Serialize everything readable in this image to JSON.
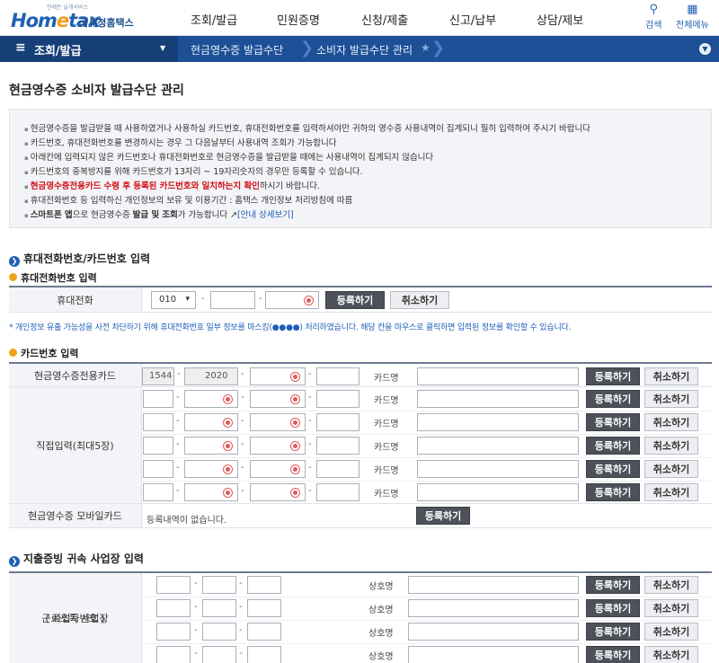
{
  "header": {
    "logo_tag": "언제든 날개서비스",
    "logo_main_a": "Hom",
    "logo_main_e": "e",
    "logo_main_b": "tax",
    "logo_sub": "국세청홈택스",
    "nav": [
      "조회/발급",
      "민원증명",
      "신청/제출",
      "신고/납부",
      "상담/제보"
    ],
    "search_label": "검색",
    "menu_label": "전체메뉴",
    "search_icon": "search-icon",
    "menu_icon": "grid-icon"
  },
  "breadcrumb": {
    "menu_glyph": "≡",
    "section": "조회/발급",
    "item1": "현금영수증 발급수단",
    "item2": "소비자 발급수단 관리"
  },
  "page_title": "현금영수증 소비자 발급수단 관리",
  "notice": {
    "lines": [
      "현금영수증을 발급받을 때 사용하였거나 사용하실 카드번호, 휴대전화번호를 입력하셔야만 귀하의 영수증 사용내역이 집계되니 필히 입력하여 주시기 바랍니다",
      "카드번호, 휴대전화번호를 변경하시는 경우 그 다음날부터 사용내역 조회가 가능합니다",
      "아래칸에 입력되지 않은 카드번호나 휴대전화번호로 현금영수증을 발급받을 때에는 사용내역이 집계되지 않습니다",
      "카드번호의 중복방지를 위해 카드번호가 13자리 ~ 19자리숫자의 경우만 등록할 수 있습니다."
    ],
    "red_line": "현금영수증전용카드 수령 후 등록된 카드번호와 일치하는지 확인",
    "red_line_tail": "하시기 바랍니다.",
    "privacy_line": "휴대전화번호 등 입력하신 개인정보의 보유 및 이용기간 : 홈택스 개인정보 처리방침에 따름",
    "smart_a": "스마트폰 앱",
    "smart_b": "으로 현금영수증 ",
    "smart_c": "발급 및 조회",
    "smart_d": "가 가능합니다 ",
    "smart_link": "[안내 상세보기]"
  },
  "sec1": {
    "title": "휴대전화번호/카드번호 입력",
    "phone_sub": "휴대전화번호 입력",
    "phone_label": "휴대전화",
    "phone_prefix": "010",
    "phone_prefix_arrow": "▾",
    "dash": "-",
    "register": "등록하기",
    "cancel": "취소하기",
    "mask_note": "* 개인정보 유출 가능성을 사전 차단하기 위해 휴대전화번호 일부 정보를 마스킹(●●●●) 처리하였습니다. 해당 칸을 마우스로 클릭하면 입력된 정보를 확인할 수 있습니다.",
    "card_sub": "카드번호 입력",
    "dedicated_label": "현금영수증전용카드",
    "dedicated_prefix": "1544",
    "dedicated_second": "2020",
    "card_name_label": "카드명",
    "direct_label": "직접입력(최대5장)",
    "mobile_label": "현금영수증 모바일카드",
    "mobile_empty": "등록내역이 없습니다."
  },
  "sec2": {
    "title": "지출증빙 귀속 사업장 입력",
    "biz_label_1": "근로소득 사업장",
    "biz_label_2": "( 사업자번호 )",
    "biz_name_label": "상호명",
    "register": "등록하기",
    "cancel": "취소하기"
  }
}
